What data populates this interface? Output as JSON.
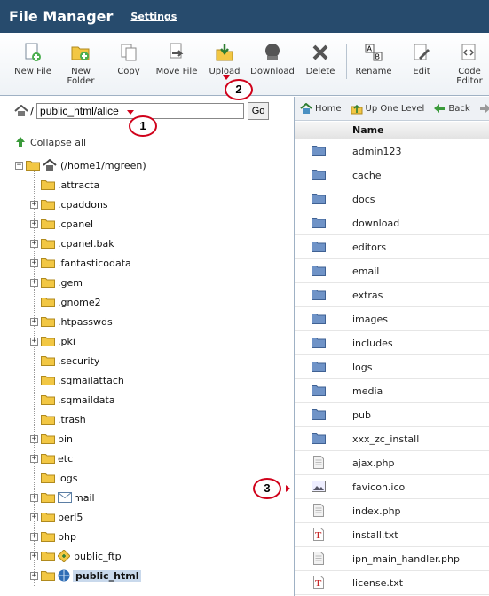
{
  "header": {
    "title": "File Manager",
    "settings_link": "Settings"
  },
  "toolbar": {
    "new_file": "New File",
    "new_folder_1": "New",
    "new_folder_2": "Folder",
    "copy": "Copy",
    "move_file": "Move File",
    "upload": "Upload",
    "download": "Download",
    "delete": "Delete",
    "rename": "Rename",
    "edit": "Edit",
    "code_editor_1": "Code",
    "code_editor_2": "Editor"
  },
  "callouts": {
    "c1": "1",
    "c2": "2",
    "c3": "3"
  },
  "left": {
    "path_value": "public_html/alice",
    "go_label": "Go",
    "collapse_all": "Collapse all",
    "root_label": "(/home1/mgreen)",
    "folders": [
      ".attracta",
      ".cpaddons",
      ".cpanel",
      ".cpanel.bak",
      ".fantasticodata",
      ".gem",
      ".gnome2",
      ".htpasswds",
      ".pki",
      ".security",
      ".sqmailattach",
      ".sqmaildata",
      ".trash",
      "bin",
      "etc",
      "logs",
      "mail",
      "perl5",
      "php",
      "public_ftp",
      "public_html"
    ]
  },
  "right": {
    "nav": {
      "home": "Home",
      "up": "Up One Level",
      "back": "Back"
    },
    "column_name": "Name",
    "files": [
      "admin123",
      "cache",
      "docs",
      "download",
      "editors",
      "email",
      "extras",
      "images",
      "includes",
      "logs",
      "media",
      "pub",
      "xxx_zc_install",
      "ajax.php",
      "favicon.ico",
      "index.php",
      "install.txt",
      "ipn_main_handler.php",
      "license.txt"
    ]
  },
  "colors": {
    "header_bg": "#274b6d",
    "callout_border": "#d0021b",
    "folder_yellow": "#f2c744",
    "folder_blue": "#5b82b8"
  }
}
